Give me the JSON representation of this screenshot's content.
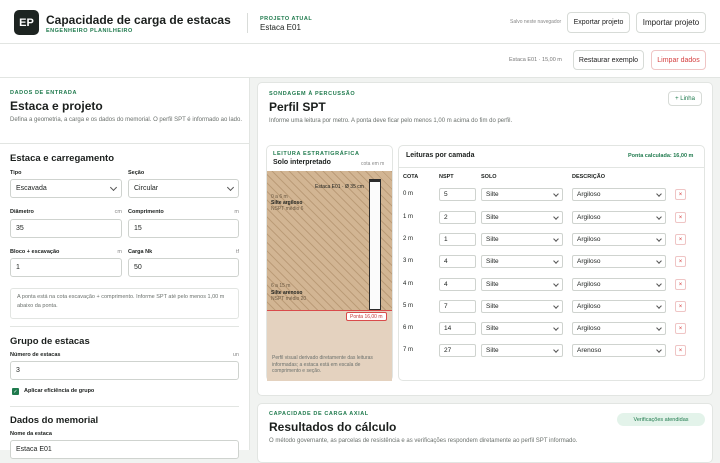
{
  "header": {
    "logo": "EP",
    "title": "Capacidade de carga de estacas",
    "subtitle": "ENGENHEIRO PLANILHEIRO",
    "project_label": "PROJETO ATUAL",
    "project_name": "Estaca E01",
    "save_note": "Salvo neste navegador",
    "export_label": "Exportar projeto",
    "import_label": "Importar projeto"
  },
  "toolbar": {
    "summary": "Estaca E01 · 15,00 m",
    "restore_label": "Restaurar exemplo",
    "clear_label": "Limpar dados"
  },
  "input_panel": {
    "eyebrow": "DADOS DE ENTRADA",
    "title": "Estaca e projeto",
    "description": "Defina a geometria, a carga e os dados do memorial. O perfil SPT é informado ao lado.",
    "section_pile": "Estaca e carregamento",
    "tipo_label": "Tipo",
    "tipo_value": "Escavada",
    "secao_label": "Seção",
    "secao_value": "Circular",
    "diametro_label": "Diâmetro",
    "diametro_unit": "cm",
    "diametro_value": "35",
    "comprimento_label": "Comprimento",
    "comprimento_unit": "m",
    "comprimento_value": "15",
    "bloco_label": "Bloco + escavação",
    "bloco_unit": "m",
    "bloco_value": "1",
    "carga_label": "Carga Nk",
    "carga_unit": "tf",
    "carga_value": "50",
    "note": "A ponta está na cota escavação + comprimento. Informe SPT até pelo menos 1,00 m abaixo da ponta.",
    "section_group": "Grupo de estacas",
    "num_label": "Número de estacas",
    "num_unit": "un",
    "num_value": "3",
    "eff_label": "Aplicar eficiência de grupo",
    "section_memo": "Dados do memorial",
    "nome_label": "Nome da estaca",
    "nome_value": "Estaca E01"
  },
  "spt": {
    "eyebrow": "SONDAGEM À PERCUSSÃO",
    "title": "Perfil SPT",
    "description": "Informe uma leitura por metro. A ponta deve ficar pelo menos 1,00 m acima do fim do perfil.",
    "add_label": "+ Linha",
    "strat_eyebrow": "LEITURA ESTRATIGRÁFICA",
    "strat_title": "Solo interpretado",
    "strat_unit": "cota em m",
    "pile_label": "Estaca E01 · Ø 35 cm",
    "layer1_depth": "0 a 6 m",
    "layer1_name": "Silte argiloso",
    "layer1_nspt": "NSPT médio 6",
    "layer2_depth": "6 a 15 m",
    "layer2_name": "Silte arenoso",
    "layer2_nspt": "NSPT médio 20",
    "tip_label": "Ponta 16,00 m",
    "strat_note": "Perfil visual derivado diretamente das leituras informadas; a estaca está em escala de comprimento e seção.",
    "table_title": "Leituras por camada",
    "tip_calc": "Ponta calculada: 16,00 m",
    "columns": [
      "COTA",
      "NSPT",
      "SOLO",
      "DESCRIÇÃO"
    ],
    "rows": [
      {
        "cota": "0 m",
        "nspt": "5",
        "solo": "Silte",
        "desc": "Argiloso"
      },
      {
        "cota": "1 m",
        "nspt": "2",
        "solo": "Silte",
        "desc": "Argiloso"
      },
      {
        "cota": "2 m",
        "nspt": "1",
        "solo": "Silte",
        "desc": "Argiloso"
      },
      {
        "cota": "3 m",
        "nspt": "4",
        "solo": "Silte",
        "desc": "Argiloso"
      },
      {
        "cota": "4 m",
        "nspt": "4",
        "solo": "Silte",
        "desc": "Argiloso"
      },
      {
        "cota": "5 m",
        "nspt": "7",
        "solo": "Silte",
        "desc": "Argiloso"
      },
      {
        "cota": "6 m",
        "nspt": "14",
        "solo": "Silte",
        "desc": "Argiloso"
      },
      {
        "cota": "7 m",
        "nspt": "27",
        "solo": "Silte",
        "desc": "Arenoso"
      }
    ],
    "remove_icon": "×"
  },
  "results": {
    "eyebrow": "CAPACIDADE DE CARGA AXIAL",
    "title": "Resultados do cálculo",
    "description": "O método governante, as parcelas de resistência e as verificações respondem diretamente ao perfil SPT informado.",
    "status": "Verificações atendidas"
  },
  "colors": {
    "accent": "#1f7a4d",
    "danger": "#d43d3d",
    "dark": "#1d2421"
  }
}
